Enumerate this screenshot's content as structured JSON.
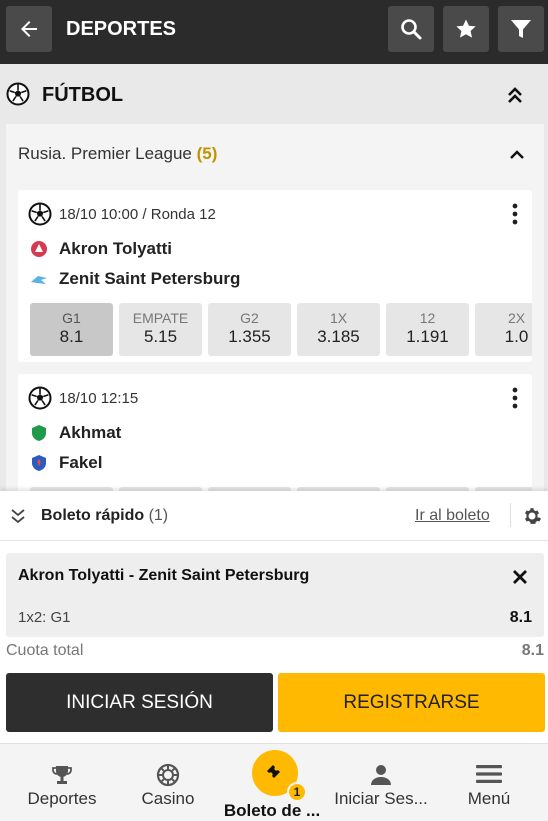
{
  "header": {
    "title": "DEPORTES"
  },
  "sport": {
    "title": "FÚTBOL"
  },
  "league": {
    "name": "Rusia. Premier League",
    "count": "(5)"
  },
  "events": [
    {
      "meta": "18/10 10:00 / Ronda 12",
      "home": "Akron Tolyatti",
      "away": "Zenit Saint Petersburg",
      "odds": [
        {
          "label": "G1",
          "value": "8.1",
          "selected": true
        },
        {
          "label": "EMPATE",
          "value": "5.15"
        },
        {
          "label": "G2",
          "value": "1.355"
        },
        {
          "label": "1X",
          "value": "3.185"
        },
        {
          "label": "12",
          "value": "1.191"
        },
        {
          "label": "2X",
          "value": "1.0"
        }
      ]
    },
    {
      "meta": "18/10 12:15",
      "home": "Akhmat",
      "away": "Fakel"
    }
  ],
  "slip": {
    "title": "Boleto rápido",
    "count": "(1)",
    "link": "Ir al boleto",
    "selection": {
      "match": "Akron Tolyatti - Zenit Saint Petersburg",
      "market": "1x2: G1",
      "odd": "8.1"
    },
    "total_label": "Cuota total",
    "total_value": "8.1",
    "login": "INICIAR SESIÓN",
    "register": "REGISTRARSE"
  },
  "nav": {
    "deportes": "Deportes",
    "casino": "Casino",
    "boleto": "Boleto de ...",
    "boleto_badge": "1",
    "iniciar": "Iniciar Ses...",
    "menu": "Menú"
  },
  "colors": {
    "accent": "#ffb900",
    "header": "#2b2b2b",
    "count": "#c29300"
  }
}
